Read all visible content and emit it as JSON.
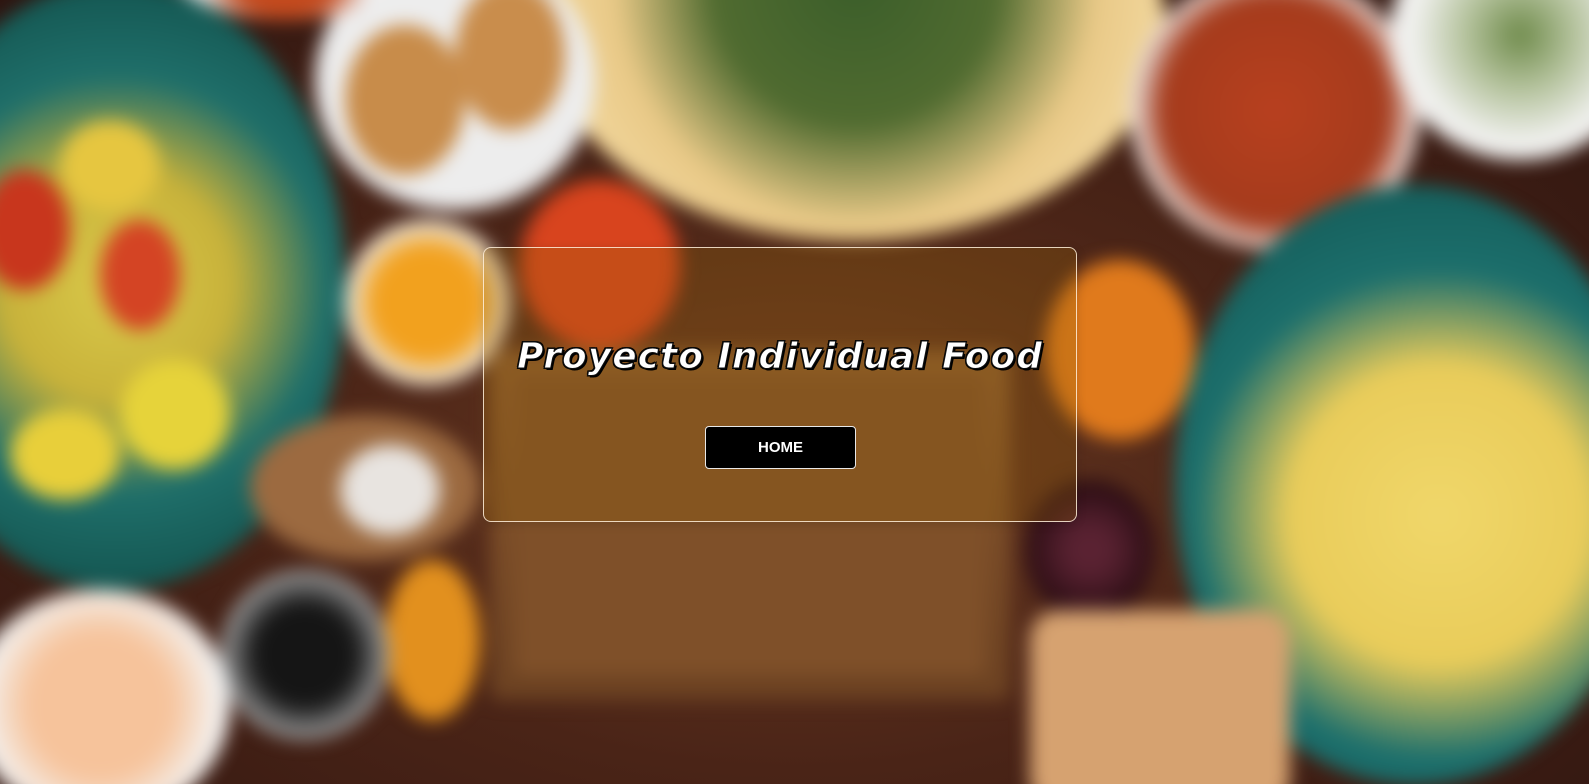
{
  "landing": {
    "title": "Proyecto Individual Food",
    "home_button_label": "HOME"
  },
  "colors": {
    "card_border": "#fff0dc",
    "button_bg": "#000000",
    "button_text": "#ffffff",
    "title_text": "#ffffff"
  },
  "background": {
    "description_icon": "food-table-photo"
  }
}
